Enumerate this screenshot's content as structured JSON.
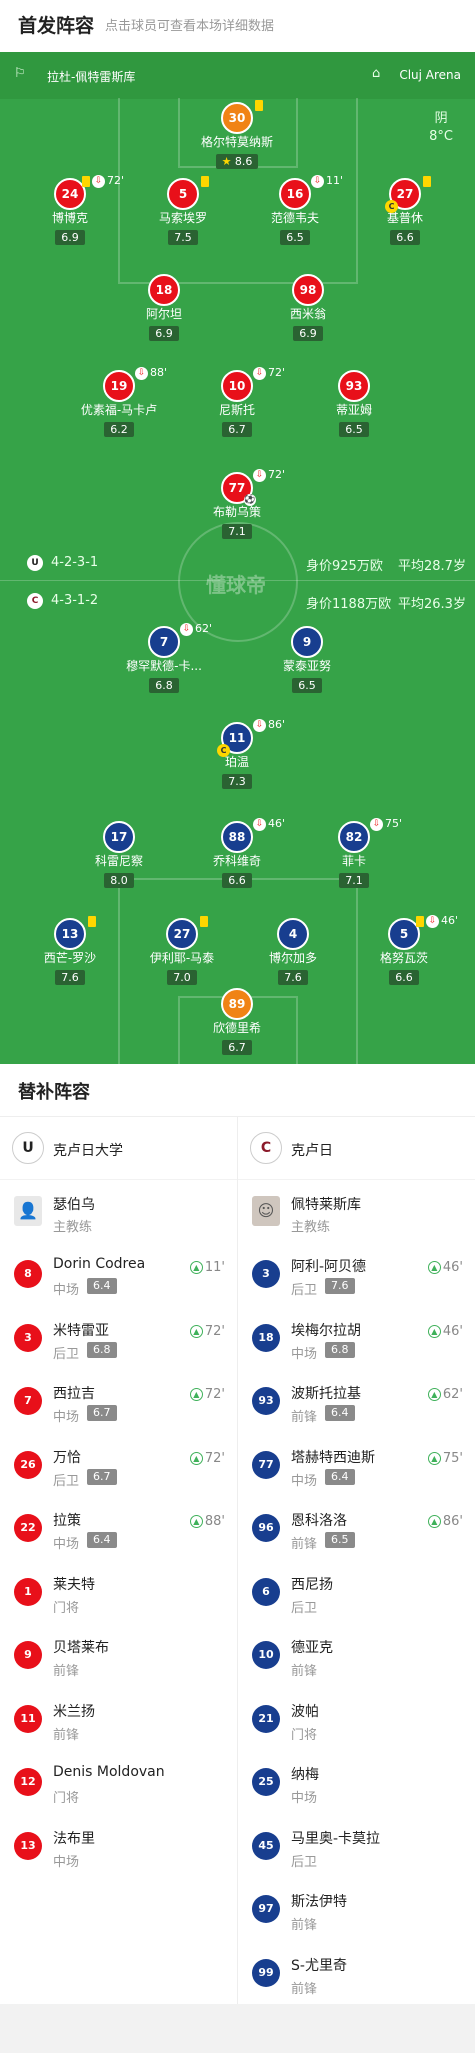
{
  "header": {
    "title": "首发阵容",
    "subtitle": "点击球员可查看本场详细数据"
  },
  "venue": {
    "city": "拉杜-佩特雷斯库",
    "stadium": "Cluj Arena"
  },
  "weather": {
    "condition": "阴",
    "temp": "8°C"
  },
  "watermark": "懂球帝",
  "home_info": {
    "formation": "4-2-3-1",
    "value": "身价925万欧",
    "avg_age": "平均28.7岁"
  },
  "away_info": {
    "formation": "4-3-1-2",
    "value": "身价1188万欧",
    "avg_age": "平均26.3岁"
  },
  "home_players": [
    {
      "num": "30",
      "name": "格尔特莫纳斯",
      "rating": "8.6",
      "color": "#f08315"
    },
    {
      "num": "24",
      "name": "博博克",
      "rating": "6.9",
      "sub": "72'",
      "color": "#e8101a"
    },
    {
      "num": "5",
      "name": "马索埃罗",
      "rating": "7.5",
      "color": "#e8101a"
    },
    {
      "num": "16",
      "name": "范德韦夫",
      "rating": "6.5",
      "sub": "11'",
      "color": "#e8101a"
    },
    {
      "num": "27",
      "name": "基普休",
      "rating": "6.6",
      "color": "#e8101a"
    },
    {
      "num": "18",
      "name": "阿尔坦",
      "rating": "6.9",
      "color": "#e8101a"
    },
    {
      "num": "98",
      "name": "西米翁",
      "rating": "6.9",
      "color": "#e8101a"
    },
    {
      "num": "19",
      "name": "优素福-马卡卢",
      "rating": "6.2",
      "sub": "88'",
      "color": "#e8101a"
    },
    {
      "num": "10",
      "name": "尼斯托",
      "rating": "6.7",
      "sub": "72'",
      "color": "#e8101a"
    },
    {
      "num": "93",
      "name": "蒂亚姆",
      "rating": "6.5",
      "color": "#e8101a"
    },
    {
      "num": "77",
      "name": "布勒乌策",
      "rating": "7.1",
      "sub": "72'",
      "color": "#e8101a"
    }
  ],
  "away_players": [
    {
      "num": "7",
      "name": "穆罕默德-卡...",
      "rating": "6.8",
      "sub": "62'",
      "color": "#183e8f"
    },
    {
      "num": "9",
      "name": "蒙泰亚努",
      "rating": "6.5",
      "color": "#183e8f"
    },
    {
      "num": "11",
      "name": "珀温",
      "rating": "7.3",
      "sub": "86'",
      "color": "#183e8f"
    },
    {
      "num": "17",
      "name": "科雷尼察",
      "rating": "8.0",
      "color": "#183e8f"
    },
    {
      "num": "88",
      "name": "乔科维奇",
      "rating": "6.6",
      "sub": "46'",
      "color": "#183e8f"
    },
    {
      "num": "82",
      "name": "菲卡",
      "rating": "7.1",
      "sub": "75'",
      "color": "#183e8f"
    },
    {
      "num": "13",
      "name": "西芒-罗沙",
      "rating": "7.6",
      "color": "#183e8f"
    },
    {
      "num": "27",
      "name": "伊利耶-马泰",
      "rating": "7.0",
      "color": "#183e8f"
    },
    {
      "num": "4",
      "name": "博尔加多",
      "rating": "7.6",
      "color": "#183e8f"
    },
    {
      "num": "5",
      "name": "格努瓦茨",
      "rating": "6.6",
      "sub": "46'",
      "color": "#183e8f"
    },
    {
      "num": "89",
      "name": "欣德里希",
      "rating": "6.7",
      "color": "#f08315"
    }
  ],
  "subs_title": "替补阵容",
  "home_subs": {
    "team": "克卢日大学",
    "coach": {
      "name": "瑟伯乌",
      "role": "主教练"
    },
    "players": [
      {
        "num": "8",
        "name": "Dorin Codrea",
        "pos": "中场",
        "rating": "6.4",
        "time": "11'"
      },
      {
        "num": "3",
        "name": "米特雷亚",
        "pos": "后卫",
        "rating": "6.8",
        "time": "72'"
      },
      {
        "num": "7",
        "name": "西拉吉",
        "pos": "中场",
        "rating": "6.7",
        "time": "72'"
      },
      {
        "num": "26",
        "name": "万恰",
        "pos": "后卫",
        "rating": "6.7",
        "time": "72'"
      },
      {
        "num": "22",
        "name": "拉策",
        "pos": "中场",
        "rating": "6.4",
        "time": "88'"
      },
      {
        "num": "1",
        "name": "莱夫特",
        "pos": "门将"
      },
      {
        "num": "9",
        "name": "贝塔莱布",
        "pos": "前锋"
      },
      {
        "num": "11",
        "name": "米兰扬",
        "pos": "前锋"
      },
      {
        "num": "12",
        "name": "Denis Moldovan",
        "pos": "门将"
      },
      {
        "num": "13",
        "name": "法布里",
        "pos": "中场"
      }
    ]
  },
  "away_subs": {
    "team": "克卢日",
    "coach": {
      "name": "佩特莱斯库",
      "role": "主教练"
    },
    "players": [
      {
        "num": "3",
        "name": "阿利-阿贝德",
        "pos": "后卫",
        "rating": "7.6",
        "time": "46'"
      },
      {
        "num": "18",
        "name": "埃梅尔拉胡",
        "pos": "中场",
        "rating": "6.8",
        "time": "46'"
      },
      {
        "num": "93",
        "name": "波斯托拉基",
        "pos": "前锋",
        "rating": "6.4",
        "time": "62'"
      },
      {
        "num": "77",
        "name": "塔赫特西迪斯",
        "pos": "中场",
        "rating": "6.4",
        "time": "75'"
      },
      {
        "num": "96",
        "name": "恩科洛洛",
        "pos": "前锋",
        "rating": "6.5",
        "time": "86'"
      },
      {
        "num": "6",
        "name": "西尼扬",
        "pos": "后卫"
      },
      {
        "num": "10",
        "name": "德亚克",
        "pos": "前锋"
      },
      {
        "num": "21",
        "name": "波帕",
        "pos": "门将"
      },
      {
        "num": "25",
        "name": "纳梅",
        "pos": "中场"
      },
      {
        "num": "45",
        "name": "马里奥-卡莫拉",
        "pos": "后卫"
      },
      {
        "num": "97",
        "name": "斯法伊特",
        "pos": "前锋"
      },
      {
        "num": "99",
        "name": "S-尤里奇",
        "pos": "前锋"
      }
    ]
  }
}
